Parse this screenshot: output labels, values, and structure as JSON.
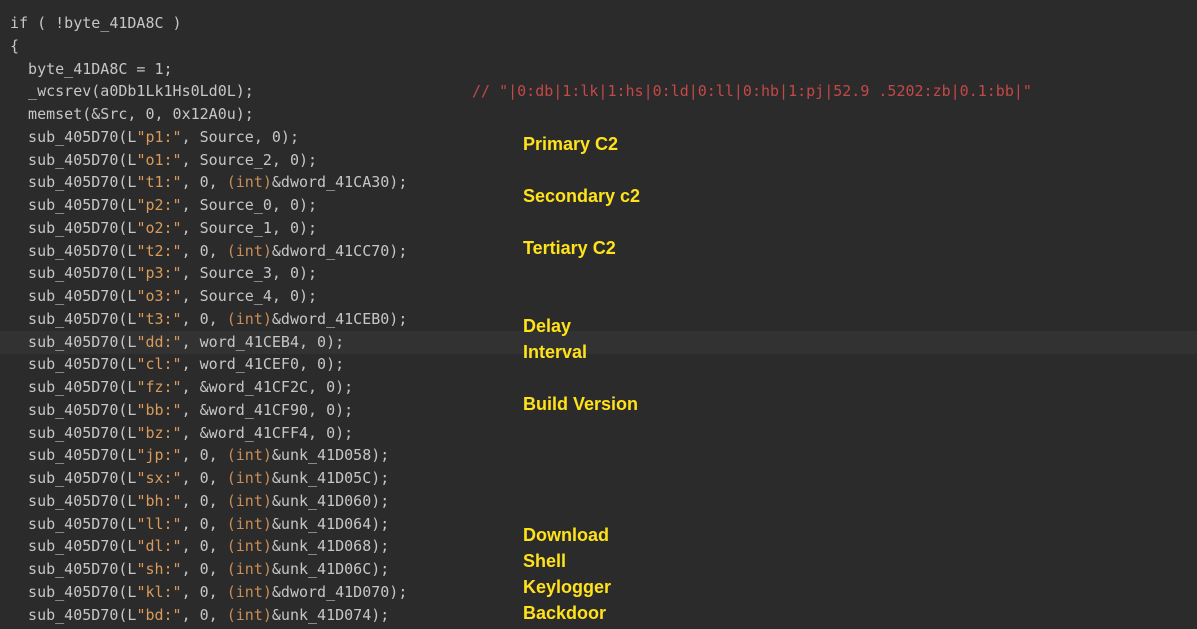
{
  "code": {
    "lines": [
      {
        "pre": "if ( !byte_41DA8C )",
        "str": "",
        "post": ""
      },
      {
        "pre": "{",
        "str": "",
        "post": ""
      },
      {
        "pre": "  byte_41DA8C = 1;",
        "str": "",
        "post": ""
      },
      {
        "pre": "  _wcsrev(a0Db1Lk1Hs0Ld0L);",
        "str": "",
        "post": "",
        "comment": "// \"|0:db|1:lk|1:hs|0:ld|0:ll|0:hb|1:pj|52.9 .5202:zb|0.1:bb|\""
      },
      {
        "pre": "  memset(&Src, 0, 0x12A0u);",
        "str": "",
        "post": ""
      },
      {
        "pre": "  sub_405D70(L",
        "str": "\"p1:\"",
        "post": ", Source, 0);"
      },
      {
        "pre": "  sub_405D70(L",
        "str": "\"o1:\"",
        "post": ", Source_2, 0);"
      },
      {
        "pre": "  sub_405D70(L",
        "str": "\"t1:\"",
        "post": ", 0, ",
        "kw": "(int)",
        "post2": "&dword_41CA30);"
      },
      {
        "pre": "  sub_405D70(L",
        "str": "\"p2:\"",
        "post": ", Source_0, 0);"
      },
      {
        "pre": "  sub_405D70(L",
        "str": "\"o2:\"",
        "post": ", Source_1, 0);"
      },
      {
        "pre": "  sub_405D70(L",
        "str": "\"t2:\"",
        "post": ", 0, ",
        "kw": "(int)",
        "post2": "&dword_41CC70);"
      },
      {
        "pre": "  sub_405D70(L",
        "str": "\"p3:\"",
        "post": ", Source_3, 0);"
      },
      {
        "pre": "  sub_405D70(L",
        "str": "\"o3:\"",
        "post": ", Source_4, 0);"
      },
      {
        "pre": "  sub_405D70(L",
        "str": "\"t3:\"",
        "post": ", 0, ",
        "kw": "(int)",
        "post2": "&dword_41CEB0);"
      },
      {
        "pre": "  sub_405D70(L",
        "str": "\"dd:\"",
        "post": ", word_41CEB4, 0);"
      },
      {
        "pre": "  sub_405D70(L",
        "str": "\"cl:\"",
        "post": ", word_41CEF0, 0);"
      },
      {
        "pre": "  sub_405D70(L",
        "str": "\"fz:\"",
        "post": ", &word_41CF2C, 0);"
      },
      {
        "pre": "  sub_405D70(L",
        "str": "\"bb:\"",
        "post": ", &word_41CF90, 0);"
      },
      {
        "pre": "  sub_405D70(L",
        "str": "\"bz:\"",
        "post": ", &word_41CFF4, 0);"
      },
      {
        "pre": "  sub_405D70(L",
        "str": "\"jp:\"",
        "post": ", 0, ",
        "kw": "(int)",
        "post2": "&unk_41D058);"
      },
      {
        "pre": "  sub_405D70(L",
        "str": "\"sx:\"",
        "post": ", 0, ",
        "kw": "(int)",
        "post2": "&unk_41D05C);"
      },
      {
        "pre": "  sub_405D70(L",
        "str": "\"bh:\"",
        "post": ", 0, ",
        "kw": "(int)",
        "post2": "&unk_41D060);"
      },
      {
        "pre": "  sub_405D70(L",
        "str": "\"ll:\"",
        "post": ", 0, ",
        "kw": "(int)",
        "post2": "&unk_41D064);"
      },
      {
        "pre": "  sub_405D70(L",
        "str": "\"dl:\"",
        "post": ", 0, ",
        "kw": "(int)",
        "post2": "&unk_41D068);"
      },
      {
        "pre": "  sub_405D70(L",
        "str": "\"sh:\"",
        "post": ", 0, ",
        "kw": "(int)",
        "post2": "&unk_41D06C);"
      },
      {
        "pre": "  sub_405D70(L",
        "str": "\"kl:\"",
        "post": ", 0, ",
        "kw": "(int)",
        "post2": "&dword_41D070);"
      },
      {
        "pre": "  sub_405D70(L",
        "str": "\"bd:\"",
        "post": ", 0, ",
        "kw": "(int)",
        "post2": "&unk_41D074);"
      }
    ],
    "highlighted_line": 14
  },
  "annotations": {
    "primary": "Primary C2",
    "secondary": "Secondary c2",
    "tertiary": "Tertiary C2",
    "delay": "Delay",
    "interval": "Interval",
    "build": "Build Version",
    "download": "Download",
    "shell": "Shell",
    "keylogger": "Keylogger",
    "backdoor": "Backdoor"
  },
  "colors": {
    "background": "#2b2b2b",
    "text": "#c6c6c6",
    "string": "#d99a5b",
    "comment": "#c44848",
    "annotation": "#ffe21a"
  }
}
